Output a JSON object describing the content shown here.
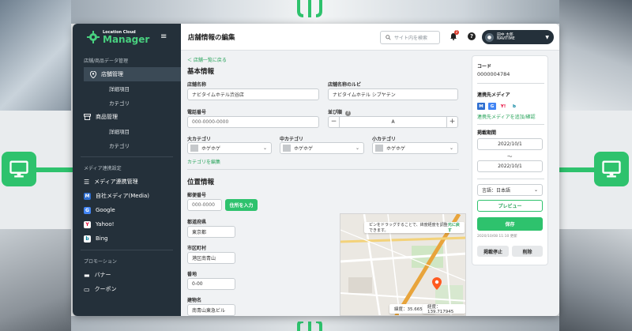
{
  "app": {
    "logo_sub": "Location Cloud",
    "logo_main": "Manager",
    "page_title": "店舗情報の編集"
  },
  "header": {
    "search_placeholder": "サイト内を検索",
    "bell_badge": "2",
    "help": "?",
    "user_name": "田中 太郎",
    "user_org": "NAVITIME"
  },
  "sidebar": {
    "section1": "店舗/商品データ管理",
    "store_manage": "店舗管理",
    "store_sub1": "詳細項目",
    "store_sub2": "カテゴリ",
    "product_manage": "商品管理",
    "product_sub1": "詳細項目",
    "product_sub2": "カテゴリ",
    "section2": "メディア連携設定",
    "media_link": "メディア連携管理",
    "own_media": "自社メディア(Media)",
    "google": "Google",
    "yahoo": "Yahoo!",
    "bing": "Bing",
    "section3": "プロモーション",
    "banner": "バナー",
    "coupon": "クーポン"
  },
  "main": {
    "back": "＜ 店舗一覧に戻る",
    "basic_title": "基本情報",
    "store_name_label": "店舗名称",
    "store_name": "ナビタイムホテル渋谷店",
    "ruby_label": "店舗名称のルビ",
    "ruby": "ナビタイムホテル シブヤテン",
    "phone_label": "電話番号",
    "phone_placeholder": "000-0000-0000",
    "order_label": "並び順",
    "order_value": "A",
    "cat_large_label": "大カテゴリ",
    "cat_mid_label": "中カテゴリ",
    "cat_small_label": "小カテゴリ",
    "cat_value": "ホゲホゲ",
    "edit_category": "カテゴリを編集",
    "location_title": "位置情報",
    "zip_label": "郵便番号",
    "zip_placeholder": "000-0000",
    "zip_button": "住所を入力",
    "pref_label": "都道府県",
    "pref": "東京都",
    "city_label": "市区町村",
    "city": "港区南青山",
    "block_label": "番地",
    "block": "0-00",
    "building_label": "建物名",
    "building": "南青山東急ビル",
    "map_tip": "ピンをドラッグすることで、緯度経度を調整できます。",
    "map_reset": "元に戻す",
    "lat": "緯度：35.665525",
    "lng": "経度：139.717945"
  },
  "panel": {
    "code_label": "コード",
    "code": "0000004784",
    "media_label": "連携先メディア",
    "media_link": "連携先メディアを追加/確認",
    "period_label": "掲載期間",
    "start": "2022/10/1",
    "tilde": "〜",
    "end": "2022/10/1",
    "lang": "言語：日本語",
    "preview": "プレビュー",
    "save": "保存",
    "updated": "2020/10/08 11:10 更新",
    "stop": "掲載停止",
    "delete": "削除"
  },
  "colors": {
    "accent": "#2ec26d",
    "sidebar": "#24303a",
    "google_blue": "#4285f4",
    "yahoo_red": "#e60033",
    "bing_teal": "#00809d"
  }
}
